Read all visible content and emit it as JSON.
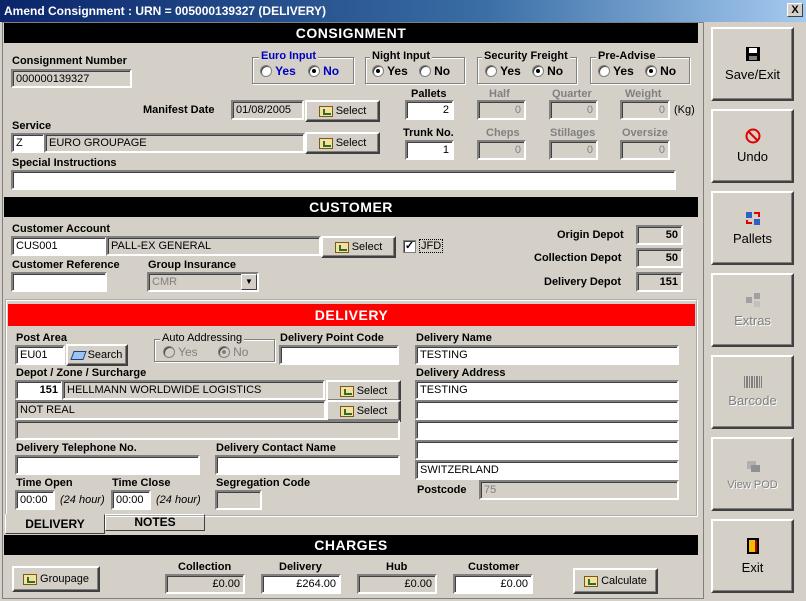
{
  "window": {
    "title": "Amend Consignment : URN = 005000139327 (DELIVERY)",
    "close": "X"
  },
  "sections": {
    "consignment": "CONSIGNMENT",
    "customer": "CUSTOMER",
    "delivery": "DELIVERY",
    "charges": "CHARGES"
  },
  "select_label": "Select",
  "consignment": {
    "number_label": "Consignment Number",
    "number_value": "000000139327",
    "euro_input": {
      "title": "Euro Input",
      "yes": "Yes",
      "no": "No",
      "selected": "No"
    },
    "night_input": {
      "title": "Night Input",
      "yes": "Yes",
      "no": "No",
      "selected": "Yes"
    },
    "security_freight": {
      "title": "Security Freight",
      "yes": "Yes",
      "no": "No",
      "selected": "No"
    },
    "pre_advise": {
      "title": "Pre-Advise",
      "yes": "Yes",
      "no": "No",
      "selected": "No"
    },
    "manifest_label": "Manifest Date",
    "manifest_value": "01/08/2005",
    "service_label": "Service",
    "service_code": "Z",
    "service_name": "EURO GROUPAGE",
    "special_label": "Special Instructions",
    "special_value": "",
    "pallets_label": "Pallets",
    "pallets_value": "2",
    "half_label": "Half",
    "half_value": "0",
    "quarter_label": "Quarter",
    "quarter_value": "0",
    "weight_label": "Weight",
    "weight_value": "0",
    "weight_unit": "(Kg)",
    "trunk_label": "Trunk No.",
    "trunk_value": "1",
    "cheps_label": "Cheps",
    "cheps_value": "0",
    "stillages_label": "Stillages",
    "stillages_value": "0",
    "oversize_label": "Oversize",
    "oversize_value": "0"
  },
  "customer": {
    "account_label": "Customer Account",
    "account_code": "CUS001",
    "account_name": "PALL-EX GENERAL",
    "jfd_label": "JFD",
    "jfd_checked": true,
    "jfd_mark": "✓",
    "reference_label": "Customer Reference",
    "reference_value": "",
    "insurance_label": "Group Insurance",
    "insurance_value": "CMR",
    "origin_label": "Origin Depot",
    "origin_value": "50",
    "collection_label": "Collection Depot",
    "collection_value": "50",
    "delivery_depot_label": "Delivery Depot",
    "delivery_depot_value": "151"
  },
  "delivery": {
    "post_area_label": "Post Area",
    "post_area_value": "EU01",
    "search_label": "Search",
    "auto_title": "Auto Addressing",
    "auto_yes": "Yes",
    "auto_no": "No",
    "auto_selected": "No",
    "dpc_label": "Delivery Point Code",
    "dpc_value": "",
    "depot_label": "Depot / Zone / Surcharge",
    "depot_num": "151",
    "depot_name": "HELLMANN WORLDWIDE LOGISTICS",
    "zone_value": "NOT REAL",
    "surcharge_value": "",
    "phone_label": "Delivery Telephone No.",
    "phone_value": "",
    "contact_label": "Delivery Contact Name",
    "contact_value": "",
    "time_open_label": "Time Open",
    "time_open_value": "00:00",
    "h24": "(24 hour)",
    "time_close_label": "Time Close",
    "time_close_value": "00:00",
    "segregation_label": "Segregation Code",
    "segregation_value": "",
    "name_label": "Delivery Name",
    "name_value": "TESTING",
    "address_label": "Delivery Address",
    "address_lines": [
      "TESTING",
      "",
      "",
      "",
      "SWITZERLAND"
    ],
    "postcode_label": "Postcode",
    "postcode_value": "75"
  },
  "tabs": {
    "delivery": "DELIVERY",
    "notes": "NOTES",
    "active": "DELIVERY"
  },
  "charges": {
    "groupage_label": "Groupage",
    "collection_label": "Collection",
    "collection_value": "£0.00",
    "delivery_label": "Delivery",
    "delivery_value": "£264.00",
    "hub_label": "Hub",
    "hub_value": "£0.00",
    "customer_label": "Customer",
    "customer_value": "£0.00",
    "calculate_label": "Calculate"
  },
  "sidebar": {
    "save": {
      "label": "Save/Exit",
      "icon": "floppy-disk-icon",
      "enabled": true
    },
    "undo": {
      "label": "Undo",
      "icon": "no-entry-icon",
      "enabled": true
    },
    "pallets": {
      "label": "Pallets",
      "icon": "pallets-icon",
      "enabled": true
    },
    "extras": {
      "label": "Extras",
      "icon": "extras-icon",
      "enabled": false
    },
    "barcode": {
      "label": "Barcode",
      "icon": "barcode-icon",
      "enabled": false
    },
    "pod": {
      "label": "View POD",
      "icon": "pod-icon",
      "enabled": false
    },
    "exit": {
      "label": "Exit",
      "icon": "exit-door-icon",
      "enabled": true
    }
  },
  "colors": {
    "delivery_bar": "#ff0000",
    "section_bar": "#000000",
    "radio_title": "#0000c0"
  }
}
